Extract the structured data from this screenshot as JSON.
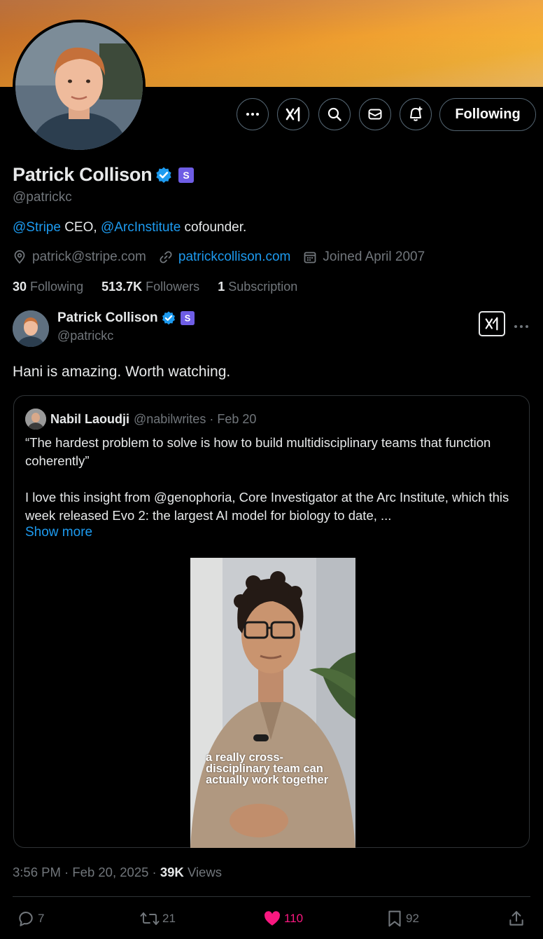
{
  "profile": {
    "name": "Patrick Collison",
    "handle": "@patrickc",
    "bio_mention_1": "@Stripe",
    "bio_text_1": " CEO, ",
    "bio_mention_2": "@ArcInstitute",
    "bio_text_2": " cofounder.",
    "email": "patrick@stripe.com",
    "website": "patrickcollison.com",
    "joined": "Joined April 2007",
    "following_count": "30",
    "following_label": "Following",
    "followers_count": "513.7K",
    "followers_label": "Followers",
    "subscription_count": "1",
    "subscription_label": "Subscription",
    "follow_button": "Following"
  },
  "header_icons": [
    "more-icon",
    "grok-icon",
    "search-icon",
    "message-icon",
    "notification-bell-icon"
  ],
  "tweet": {
    "author_name": "Patrick Collison",
    "author_handle": "@patrickc",
    "text": "Hani is amazing. Worth watching.",
    "time": "3:56 PM",
    "date": "Feb 20, 2025",
    "views_count": "39K",
    "views_label": "Views",
    "replies": "7",
    "retweets": "21",
    "likes": "110",
    "bookmarks": "92"
  },
  "quote": {
    "author_name": "Nabil Laoudji",
    "author_handle": "@nabilwrites",
    "date": "Feb 20",
    "paragraph_1": "“The hardest problem to solve is how to build multidisciplinary teams that function coherently”",
    "paragraph_2": "I love this insight from @genophoria, Core Investigator at the Arc Institute, which this week released Evo 2: the largest AI model for biology to date, ...",
    "show_more": "Show more",
    "video_caption": "a really cross-disciplinary team can actually work together"
  },
  "colors": {
    "accent": "#1d9bf0",
    "like": "#f91880",
    "verified": "#1d9bf0",
    "subscription_badge": "#6e5de5"
  }
}
